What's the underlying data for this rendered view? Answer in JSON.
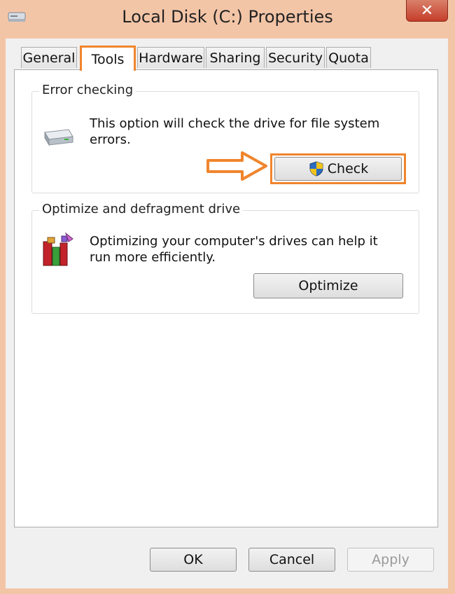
{
  "window": {
    "title": "Local Disk (C:) Properties",
    "close_label": "✕"
  },
  "tabs": [
    {
      "label": "General"
    },
    {
      "label": "Tools"
    },
    {
      "label": "Hardware"
    },
    {
      "label": "Sharing"
    },
    {
      "label": "Security"
    },
    {
      "label": "Quota"
    }
  ],
  "active_tab": "Tools",
  "error_checking": {
    "title": "Error checking",
    "description": "This option will check the drive for file system errors.",
    "button_label": "Check",
    "icon": "drive-icon"
  },
  "optimize": {
    "title": "Optimize and defragment drive",
    "description": "Optimizing your computer's drives can help it run more efficiently.",
    "button_label": "Optimize",
    "icon": "defrag-icon"
  },
  "footer": {
    "ok_label": "OK",
    "cancel_label": "Cancel",
    "apply_label": "Apply"
  },
  "colors": {
    "highlight": "#f0852d",
    "close_button": "#c53d2a"
  }
}
